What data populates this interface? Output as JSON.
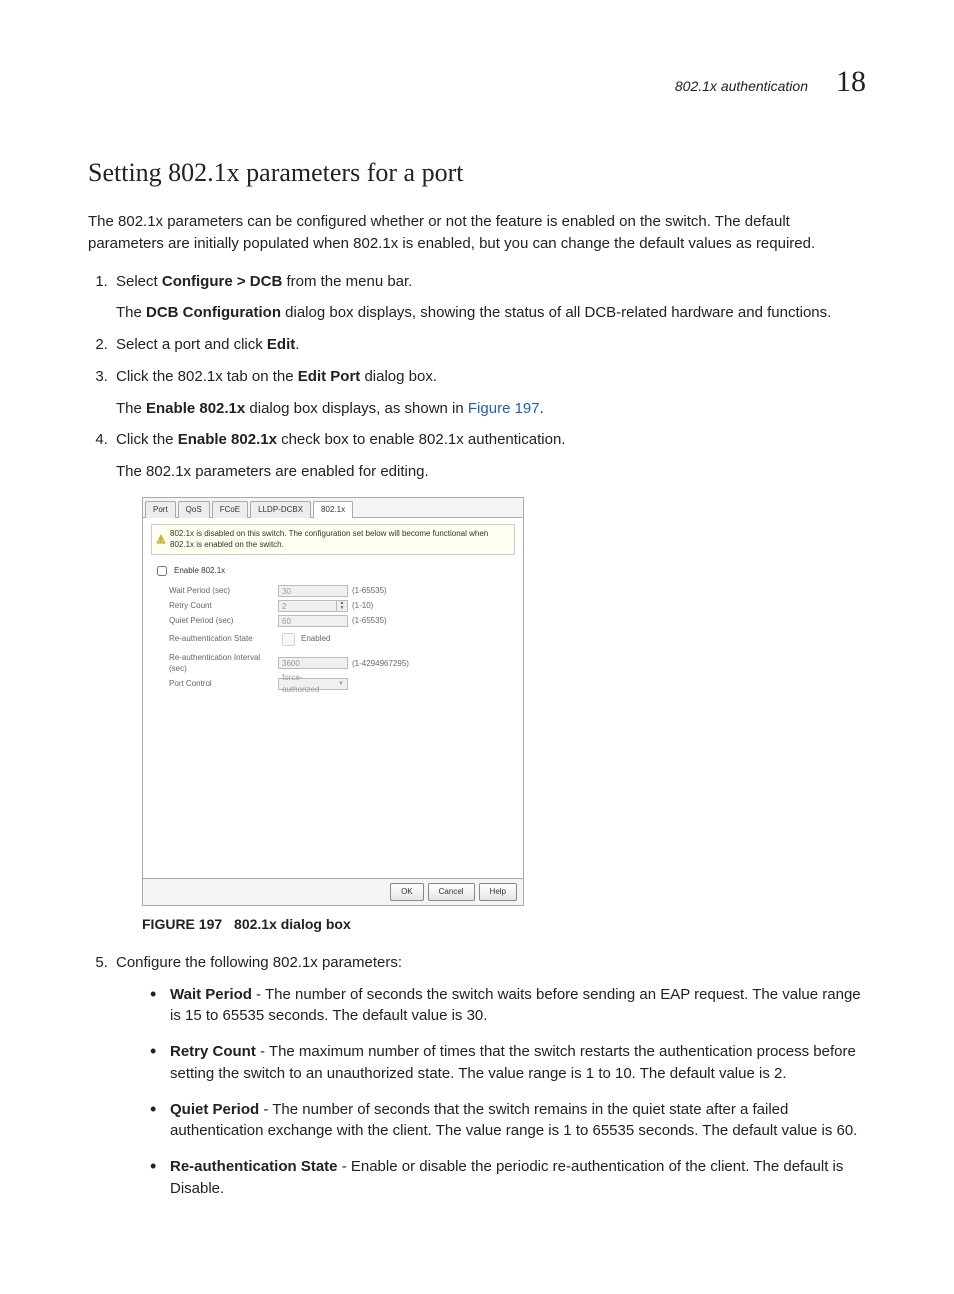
{
  "header": {
    "section": "802.1x authentication",
    "chapter": "18"
  },
  "title": "Setting 802.1x parameters for a port",
  "intro": "The 802.1x parameters can be configured whether or not the feature is enabled on the switch. The default parameters are initially populated when 802.1x is enabled, but you can change the default values as required.",
  "steps": {
    "s1a": "Select ",
    "s1b": "Configure > DCB",
    "s1c": " from the menu bar.",
    "s1_sub_a": "The ",
    "s1_sub_b": "DCB Configuration",
    "s1_sub_c": " dialog box displays, showing the status of all DCB-related hardware and functions.",
    "s2a": "Select a port and click ",
    "s2b": "Edit",
    "s2c": ".",
    "s3a": "Click the 802.1x tab on the ",
    "s3b": "Edit Port",
    "s3c": " dialog box.",
    "s3_sub_a": "The ",
    "s3_sub_b": "Enable 802.1x",
    "s3_sub_c": " dialog box displays, as shown in ",
    "s3_sub_link": "Figure 197",
    "s3_sub_d": ".",
    "s4a": "Click the ",
    "s4b": "Enable 802.1x",
    "s4c": " check box to enable 802.1x authentication.",
    "s4_sub": "The 802.1x parameters are enabled for editing.",
    "s5": "Configure the following 802.1x parameters:"
  },
  "figure": {
    "caption_num": "FIGURE 197",
    "caption_title": "802.1x dialog box",
    "tabs": {
      "port": "Port",
      "qos": "QoS",
      "fcoe": "FCoE",
      "lldp": "LLDP-DCBX",
      "x8021": "802.1x"
    },
    "warning": "802.1x is disabled on this switch. The configuration set below will become functional when 802.1x is enabled on the switch.",
    "enable_label": "Enable 802.1x",
    "fields": {
      "wait_label": "Wait Period (sec)",
      "wait_val": "30",
      "wait_range": "(1-65535)",
      "retry_label": "Retry Count",
      "retry_val": "2",
      "retry_range": "(1-10)",
      "quiet_label": "Quiet Period (sec)",
      "quiet_val": "60",
      "quiet_range": "(1-65535)",
      "reauth_state_label": "Re-authentication State",
      "reauth_state_chk": "Enabled",
      "reauth_int_label": "Re-authentication Interval (sec)",
      "reauth_int_val": "3600",
      "reauth_int_range": "(1-4294967295)",
      "port_ctrl_label": "Port Control",
      "port_ctrl_val": "force-authorized"
    },
    "buttons": {
      "ok": "OK",
      "cancel": "Cancel",
      "help": "Help"
    }
  },
  "bullets": {
    "wait_t": "Wait Period",
    "wait_d": " - The number of seconds the switch waits before sending an EAP request. The value range is 15 to 65535 seconds. The default value is 30.",
    "retry_t": "Retry Count",
    "retry_d": " - The maximum number of times that the switch restarts the authentication process before setting the switch to an unauthorized state. The value range is 1 to 10. The default value is 2.",
    "quiet_t": "Quiet Period",
    "quiet_d": " - The number of seconds that the switch remains in the quiet state after a failed authentication exchange with the client. The value range is 1 to 65535 seconds. The default value is 60.",
    "reauth_t": "Re-authentication State",
    "reauth_d": " - Enable or disable the periodic re-authentication of the client. The default is Disable."
  }
}
